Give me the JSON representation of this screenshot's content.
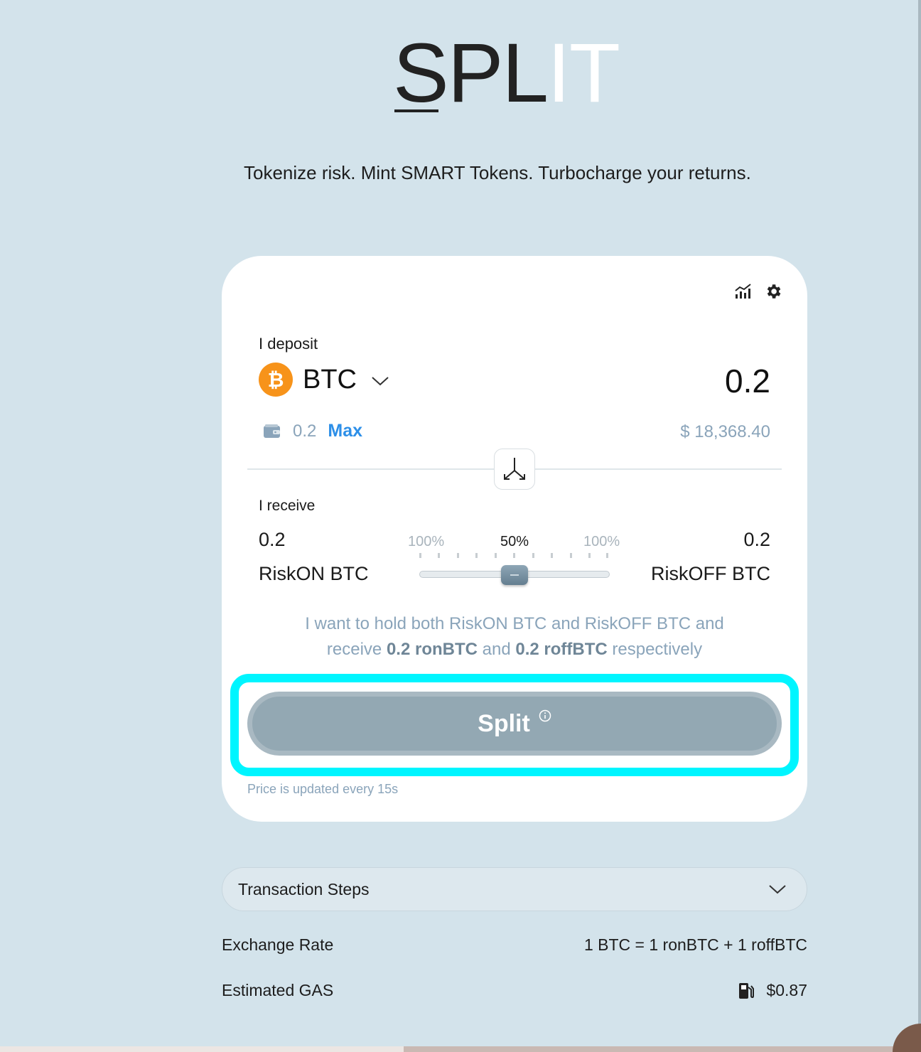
{
  "logo": {
    "dark_text": "SPL",
    "light_text": "IT"
  },
  "tagline": "Tokenize risk. Mint SMART Tokens. Turbocharge your returns.",
  "deposit": {
    "label": "I deposit",
    "token": "BTC",
    "token_symbol": "₿",
    "amount": "0.2",
    "balance": "0.2",
    "max_label": "Max",
    "usd_value": "$ 18,368.40"
  },
  "receive": {
    "label": "I receive",
    "left": {
      "amount": "0.2",
      "name": "RiskON BTC"
    },
    "right": {
      "amount": "0.2",
      "name": "RiskOFF BTC"
    },
    "slider": {
      "left_pct": "100%",
      "mid_pct": "50%",
      "right_pct": "100%",
      "value": 0.5
    }
  },
  "description": {
    "line1": "I want to hold both RiskON BTC and RiskOFF BTC and",
    "pre": "receive",
    "amt1": "0.2 ronBTC",
    "mid": "and",
    "amt2": "0.2 roffBTC",
    "post": "respectively"
  },
  "split_button": {
    "label": "Split"
  },
  "price_note": "Price is updated every 15s",
  "transaction_steps": {
    "label": "Transaction Steps"
  },
  "exchange_rate": {
    "label": "Exchange Rate",
    "value": "1 BTC = 1 ronBTC + 1 roffBTC"
  },
  "gas": {
    "label": "Estimated GAS",
    "value": "$0.87"
  },
  "colors": {
    "background": "#d3e3eb",
    "accent": "#2d8fe8",
    "btc": "#f7931a",
    "highlight": "#00f5ff",
    "button": "#93a8b3"
  }
}
